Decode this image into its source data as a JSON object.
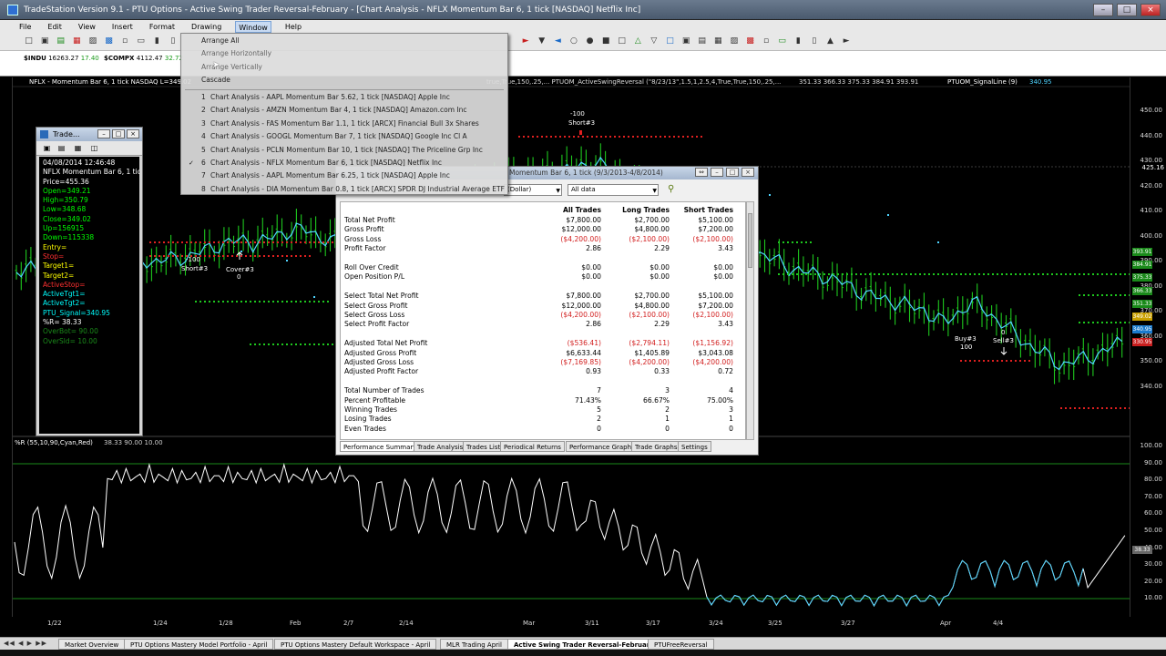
{
  "app": {
    "title": "TradeStation Version 9.1 - PTU Options - Active Swing Trader Reversal-February - [Chart Analysis - NFLX Momentum Bar 6, 1 tick [NASDAQ] Netflix Inc]"
  },
  "menu": [
    "File",
    "Edit",
    "View",
    "Insert",
    "Format",
    "Drawing",
    "Window",
    "Help"
  ],
  "quotes": [
    {
      "sym": "$INDU",
      "last": "16263.27",
      "chg": "17.40"
    },
    {
      "sym": "$COMPX",
      "last": "4112.47",
      "chg": "32.72"
    }
  ],
  "window_menu": {
    "commands": [
      "Arrange All",
      "Arrange Horizontally",
      "Arrange Vertically",
      "Cascade"
    ],
    "windows": [
      {
        "num": "1",
        "label": "Chart Analysis - AAPL Momentum Bar 5.62, 1 tick [NASDAQ] Apple Inc",
        "checked": false
      },
      {
        "num": "2",
        "label": "Chart Analysis - AMZN Momentum Bar 4, 1 tick [NASDAQ] Amazon.com Inc",
        "checked": false
      },
      {
        "num": "3",
        "label": "Chart Analysis - FAS Momentum Bar 1.1, 1 tick [ARCX] Financial Bull 3x Shares",
        "checked": false
      },
      {
        "num": "4",
        "label": "Chart Analysis - GOOGL Momentum Bar 7, 1 tick [NASDAQ] Google Inc Cl A",
        "checked": false
      },
      {
        "num": "5",
        "label": "Chart Analysis - PCLN Momentum Bar 10, 1 tick [NASDAQ] The Priceline Grp Inc",
        "checked": false
      },
      {
        "num": "6",
        "label": "Chart Analysis - NFLX Momentum Bar 6, 1 tick [NASDAQ] Netflix Inc",
        "checked": true
      },
      {
        "num": "7",
        "label": "Chart Analysis - AAPL Momentum Bar 6.25, 1 tick [NASDAQ] Apple Inc",
        "checked": false
      },
      {
        "num": "8",
        "label": "Chart Analysis - DIA Momentum Bar 0.8, 1 tick [ARCX] SPDR DJ Industrial Average ETF",
        "checked": false
      }
    ]
  },
  "chart": {
    "header_left": "NFLX - Momentum Bar 6, 1 tick  NASDAQ  L=349.02",
    "header_strategy": "true,True,150,.25,...  PTUOM_ActiveSwingReversal (\"8/23/13\",1.5,1,2.5,4,True,True,150,.25,...",
    "header_values": "351.33   366.33   375.33   384.91   393.91",
    "header_signal_name": "PTUOM_SignalLine (9)",
    "header_signal_value": "340.95",
    "indicator_header": "%R (55,10,90,Cyan,Red)",
    "indicator_values": "38.33  90.00  10.00",
    "price_axis": [
      "450.00",
      "440.00",
      "430.00",
      "420.00",
      "410.00",
      "400.00",
      "390.00",
      "380.00",
      "370.00",
      "360.00",
      "350.00",
      "340.00"
    ],
    "price_tags": [
      {
        "label": "393.91",
        "color": "#1a8a1a"
      },
      {
        "label": "384.91",
        "color": "#1a8a1a"
      },
      {
        "label": "375.33",
        "color": "#1a8a1a"
      },
      {
        "label": "366.33",
        "color": "#1a8a1a"
      },
      {
        "label": "351.33",
        "color": "#1a8a1a"
      },
      {
        "label": "349.02",
        "color": "#c9a000"
      },
      {
        "label": "340.95",
        "color": "#1a7acc"
      },
      {
        "label": "330.95",
        "color": "#c81e1e"
      }
    ],
    "last_price_marker": "425.16",
    "indicator_axis": [
      "100.00",
      "90.00",
      "80.00",
      "70.00",
      "60.00",
      "50.00",
      "40.00",
      "38.33",
      "30.00",
      "20.00",
      "10.00"
    ],
    "dates": [
      "1/22",
      "1/24",
      "1/28",
      "Feb",
      "2/7",
      "2/14",
      "Mar",
      "3/11",
      "3/17",
      "3/24",
      "3/25",
      "3/27",
      "Apr",
      "4/4"
    ],
    "annotations": [
      "-100",
      "Short#3",
      "Cover#3",
      "0",
      "-100",
      "Short#3",
      "Buy#3",
      "100",
      "0",
      "Sell#3"
    ]
  },
  "data_window": {
    "title": "Trade...",
    "lines": [
      {
        "text": "04/08/2014  12:46:48",
        "color": "#ffffff"
      },
      {
        "text": "NFLX Momentum Bar 6, 1 tick",
        "color": "#ffffff"
      },
      {
        "text": "Price=455.36",
        "color": "#ffffff"
      },
      {
        "text": "Open=349.21",
        "color": "#00ff00"
      },
      {
        "text": "High=350.79",
        "color": "#00ff00"
      },
      {
        "text": "Low=348.68",
        "color": "#00ff00"
      },
      {
        "text": "Close=349.02",
        "color": "#00ff00"
      },
      {
        "text": "Up=156915",
        "color": "#00ff00"
      },
      {
        "text": "Down=115338",
        "color": "#00ff00"
      },
      {
        "text": "Entry=",
        "color": "#ffff00"
      },
      {
        "text": "Stop=",
        "color": "#ff3030"
      },
      {
        "text": "Target1=",
        "color": "#ffff00"
      },
      {
        "text": "Target2=",
        "color": "#ffff00"
      },
      {
        "text": "ActiveStop=",
        "color": "#ff3030"
      },
      {
        "text": "ActiveTgt1=",
        "color": "#00ffff"
      },
      {
        "text": "ActiveTgt2=",
        "color": "#00ffff"
      },
      {
        "text": "PTU_Signal=340.95",
        "color": "#00ffff"
      },
      {
        "text": "%R= 38.33",
        "color": "#ffffff"
      },
      {
        "text": "OverBot= 90.00",
        "color": "#1a8a1a"
      },
      {
        "text": "OverSld= 10.00",
        "color": "#1a8a1a"
      }
    ]
  },
  "report": {
    "title": "Momentum Bar 6, 1 tick (9/3/2013-4/8/2014)",
    "filter_currency": "(Dollar)",
    "filter_trades": "All data",
    "columns": [
      "All Trades",
      "Long Trades",
      "Short Trades"
    ],
    "rows": [
      {
        "label": "Total Net Profit",
        "v": [
          "$7,800.00",
          "$2,700.00",
          "$5,100.00"
        ]
      },
      {
        "label": "Gross Profit",
        "v": [
          "$12,000.00",
          "$4,800.00",
          "$7,200.00"
        ]
      },
      {
        "label": "Gross Loss",
        "v": [
          "($4,200.00)",
          "($2,100.00)",
          "($2,100.00)"
        ]
      },
      {
        "label": "Profit Factor",
        "v": [
          "2.86",
          "2.29",
          "3.43"
        ]
      },
      {
        "label": "",
        "v": [
          "",
          "",
          ""
        ]
      },
      {
        "label": "Roll Over Credit",
        "v": [
          "$0.00",
          "$0.00",
          "$0.00"
        ]
      },
      {
        "label": "Open Position P/L",
        "v": [
          "$0.00",
          "$0.00",
          "$0.00"
        ]
      },
      {
        "label": "",
        "v": [
          "",
          "",
          ""
        ]
      },
      {
        "label": "Select Total Net Profit",
        "v": [
          "$7,800.00",
          "$2,700.00",
          "$5,100.00"
        ]
      },
      {
        "label": "Select Gross Profit",
        "v": [
          "$12,000.00",
          "$4,800.00",
          "$7,200.00"
        ]
      },
      {
        "label": "Select Gross Loss",
        "v": [
          "($4,200.00)",
          "($2,100.00)",
          "($2,100.00)"
        ]
      },
      {
        "label": "Select Profit Factor",
        "v": [
          "2.86",
          "2.29",
          "3.43"
        ]
      },
      {
        "label": "",
        "v": [
          "",
          "",
          ""
        ]
      },
      {
        "label": "Adjusted Total Net Profit",
        "v": [
          "($536.41)",
          "($2,794.11)",
          "($1,156.92)"
        ]
      },
      {
        "label": "Adjusted Gross Profit",
        "v": [
          "$6,633.44",
          "$1,405.89",
          "$3,043.08"
        ]
      },
      {
        "label": "Adjusted Gross Loss",
        "v": [
          "($7,169.85)",
          "($4,200.00)",
          "($4,200.00)"
        ]
      },
      {
        "label": "Adjusted Profit Factor",
        "v": [
          "0.93",
          "0.33",
          "0.72"
        ]
      },
      {
        "label": "",
        "v": [
          "",
          "",
          ""
        ]
      },
      {
        "label": "Total Number of Trades",
        "v": [
          "7",
          "3",
          "4"
        ]
      },
      {
        "label": "Percent Profitable",
        "v": [
          "71.43%",
          "66.67%",
          "75.00%"
        ]
      },
      {
        "label": "Winning Trades",
        "v": [
          "5",
          "2",
          "3"
        ]
      },
      {
        "label": "Losing Trades",
        "v": [
          "2",
          "1",
          "1"
        ]
      },
      {
        "label": "Even Trades",
        "v": [
          "0",
          "0",
          "0"
        ]
      }
    ],
    "tabs": [
      "Performance Summary",
      "Trade Analysis",
      "Trades List",
      "Periodical Returns",
      "Performance Graphs",
      "Trade Graphs",
      "Settings"
    ]
  },
  "workspace_tabs": [
    {
      "label": "Market Overview",
      "active": false
    },
    {
      "label": "PTU Options Mastery Model Portfolio - April",
      "active": false
    },
    {
      "label": "PTU Options Mastery Default Workspace - April",
      "active": false
    },
    {
      "label": "MLR Trading April",
      "active": false
    },
    {
      "label": "Active Swing Trader Reversal-February",
      "active": true
    },
    {
      "label": "PTUFreeReversal",
      "active": false
    }
  ],
  "colors": {
    "bar_up": "#1ec81e",
    "signal_line": "#4fd4ff",
    "stop_dots": "#e02020",
    "target_dots": "#1ec81e",
    "indicator_line": "#ffffff",
    "overbought_line": "#1a8a1a"
  }
}
